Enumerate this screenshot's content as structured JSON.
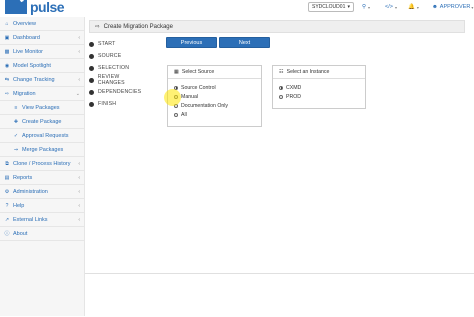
{
  "app": {
    "logo_text": "pulse",
    "colors": {
      "brand": "#2c6fb7",
      "sidebar_bg": "#f6f6f6",
      "highlight": "#ffe600"
    }
  },
  "topbar": {
    "org_select": "SYDCLOUD01",
    "search_icon": "search-icon",
    "code_icon": "code-icon",
    "notifications_icon": "bell-icon",
    "user_label": "APPROVER"
  },
  "sidebar": {
    "items": [
      {
        "label": "Overview",
        "icon": "home-icon",
        "expandable": false
      },
      {
        "label": "Dashboard",
        "icon": "dashboard-icon",
        "expandable": true
      },
      {
        "label": "Live Monitor",
        "icon": "monitor-icon",
        "expandable": true
      },
      {
        "label": "Model Spotlight",
        "icon": "spotlight-icon",
        "expandable": false
      },
      {
        "label": "Change Tracking",
        "icon": "tracking-icon",
        "expandable": true
      },
      {
        "label": "Migration",
        "icon": "migration-icon",
        "expandable": true
      },
      {
        "label": "View Packages",
        "icon": "list-icon",
        "sub": true
      },
      {
        "label": "Create Package",
        "icon": "plus-icon",
        "sub": true
      },
      {
        "label": "Approval Requests",
        "icon": "check-icon",
        "sub": true
      },
      {
        "label": "Merge Packages",
        "icon": "merge-icon",
        "sub": true
      },
      {
        "label": "Clone / Process History",
        "icon": "clone-icon",
        "expandable": true
      },
      {
        "label": "Reports",
        "icon": "reports-icon",
        "expandable": true
      },
      {
        "label": "Administration",
        "icon": "admin-icon",
        "expandable": true
      },
      {
        "label": "Help",
        "icon": "help-icon",
        "expandable": true
      },
      {
        "label": "External Links",
        "icon": "link-icon",
        "expandable": true
      },
      {
        "label": "About",
        "icon": "info-icon",
        "expandable": false
      }
    ]
  },
  "main": {
    "title": "Create Migration Package",
    "steps": [
      "START",
      "SOURCE",
      "SELECTION",
      "REVIEW CHANGES",
      "DEPENDENCIES",
      "FINISH"
    ],
    "previous_label": "Previous",
    "next_label": "Next",
    "source_card": {
      "title": "Select Source",
      "options": [
        "Source Control",
        "Manual",
        "Documentation Only",
        "All"
      ],
      "selected": "Source Control"
    },
    "instance_card": {
      "title": "Select an Instance",
      "options": [
        "CXMD",
        "PROD"
      ],
      "selected": "CXMD"
    }
  }
}
